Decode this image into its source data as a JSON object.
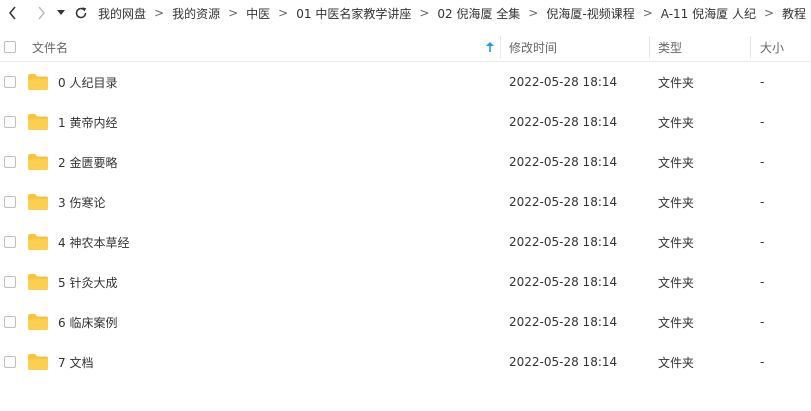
{
  "toolbar": {
    "breadcrumbs": [
      "我的网盘",
      "我的资源",
      "中医",
      "01 中医名家教学讲座",
      "02 倪海厦 全集",
      "倪海厦-视频课程",
      "A-11 倪海厦 人纪",
      "教程"
    ]
  },
  "header": {
    "name": "文件名",
    "modified": "修改时间",
    "type": "类型",
    "size": "大小"
  },
  "rows": [
    {
      "name": "0 人纪目录",
      "modified": "2022-05-28 18:14",
      "type": "文件夹",
      "size": "-"
    },
    {
      "name": "1 黄帝内经",
      "modified": "2022-05-28 18:14",
      "type": "文件夹",
      "size": "-"
    },
    {
      "name": "2 金匮要略",
      "modified": "2022-05-28 18:14",
      "type": "文件夹",
      "size": "-"
    },
    {
      "name": "3 伤寒论",
      "modified": "2022-05-28 18:14",
      "type": "文件夹",
      "size": "-"
    },
    {
      "name": "4 神农本草经",
      "modified": "2022-05-28 18:14",
      "type": "文件夹",
      "size": "-"
    },
    {
      "name": "5 针灸大成",
      "modified": "2022-05-28 18:14",
      "type": "文件夹",
      "size": "-"
    },
    {
      "name": "6 临床案例",
      "modified": "2022-05-28 18:14",
      "type": "文件夹",
      "size": "-"
    },
    {
      "name": "7 文档",
      "modified": "2022-05-28 18:14",
      "type": "文件夹",
      "size": "-"
    }
  ],
  "colors": {
    "folder": "#f9c33a",
    "sort_arrow": "#1b9aee"
  }
}
